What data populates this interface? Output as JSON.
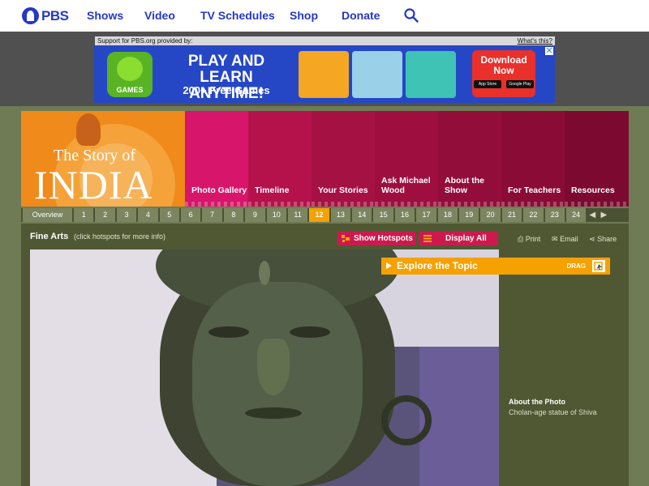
{
  "pbs_nav": {
    "logo_text": "PBS",
    "links": [
      "Shows",
      "Video",
      "TV Schedules",
      "Shop",
      "Donate"
    ],
    "search_icon": "search-icon"
  },
  "ad": {
    "support_text": "Support for PBS.org provided by:",
    "whats_this": "What's this?",
    "games_label": "GAMES",
    "headline": "PLAY AND LEARN ANYTIME!",
    "subheadline": "200+ Free Games",
    "download": "Download Now",
    "app_store": "App Store",
    "google_play": "Google Play",
    "colors": {
      "banner": "#2547c6",
      "download": "#e9302b"
    }
  },
  "india": {
    "logo_line1": "The Story of",
    "logo_line2": "INDIA",
    "nav": [
      {
        "label": "Photo Gallery",
        "color": "#d7156a"
      },
      {
        "label": "Timeline",
        "color": "#b5124c"
      },
      {
        "label": "Your Stories",
        "color": "#a61144"
      },
      {
        "label": "Ask Michael Wood",
        "color": "#9e0f40"
      },
      {
        "label": "About the Show",
        "color": "#930d3b"
      },
      {
        "label": "For Teachers",
        "color": "#8a0c36"
      },
      {
        "label": "Resources",
        "color": "#7c0a30"
      }
    ]
  },
  "gallery": {
    "overview": "Overview",
    "numbers": [
      "1",
      "2",
      "3",
      "4",
      "5",
      "6",
      "7",
      "8",
      "9",
      "10",
      "11",
      "12",
      "13",
      "14",
      "15",
      "16",
      "17",
      "18",
      "19",
      "20",
      "21",
      "22",
      "23",
      "24"
    ],
    "active": "12",
    "prev_icon": "◀",
    "next_icon": "▶"
  },
  "content": {
    "title": "Fine Arts",
    "hint": "(click hotspots for more info)",
    "show_hotspots": "Show Hotspots",
    "display_all": "Display All",
    "print": "Print",
    "email": "Email",
    "share": "Share",
    "explore": "Explore the Topic",
    "drag": "DRAG",
    "about_title": "About the Photo",
    "about_text": "Cholan-age statue of Shiva"
  }
}
